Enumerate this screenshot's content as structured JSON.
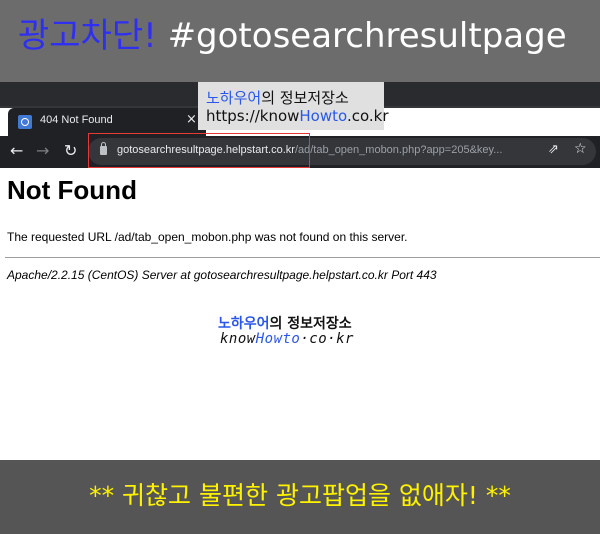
{
  "banner": {
    "title_main": "광고차단!",
    "title_hash": "#gotosearchresultpage"
  },
  "watermark": {
    "brand_blue": "노하우어",
    "brand_rest": "의 정보저장소",
    "url_prefix": "https://know",
    "url_highlight": "Howto",
    "url_suffix": ".co.kr"
  },
  "browser": {
    "tab_title": "404 Not Found",
    "tab_close": "×",
    "url_host": "gotosearchresultpage.helpstart.co.kr",
    "url_path": "/ad/tab_open_mobon.php?app=205&key...",
    "icons": {
      "back": "back-arrow-icon",
      "forward": "forward-arrow-icon",
      "reload": "reload-icon",
      "lock": "lock-icon",
      "share": "share-icon",
      "star": "star-icon"
    }
  },
  "page": {
    "heading": "Not Found",
    "message": "The requested URL /ad/tab_open_mobon.php was not found on this server.",
    "server_signature": "Apache/2.2.15 (CentOS) Server at gotosearchresultpage.helpstart.co.kr Port 443"
  },
  "logo": {
    "line1_blue": "노하우어",
    "line1_rest": "의 정보저장소",
    "line2_prefix": "know",
    "line2_highlight": "Howto",
    "line2_suffix": "·co·kr"
  },
  "bottom_banner": {
    "text": "** 귀찮고 불편한 광고팝업을 없애자! **"
  },
  "colors": {
    "banner_bg": "#6c6c6c",
    "title_blue": "#2f2ff2",
    "bottom_text": "#fff200",
    "url_highlight_border": "#e53935"
  }
}
